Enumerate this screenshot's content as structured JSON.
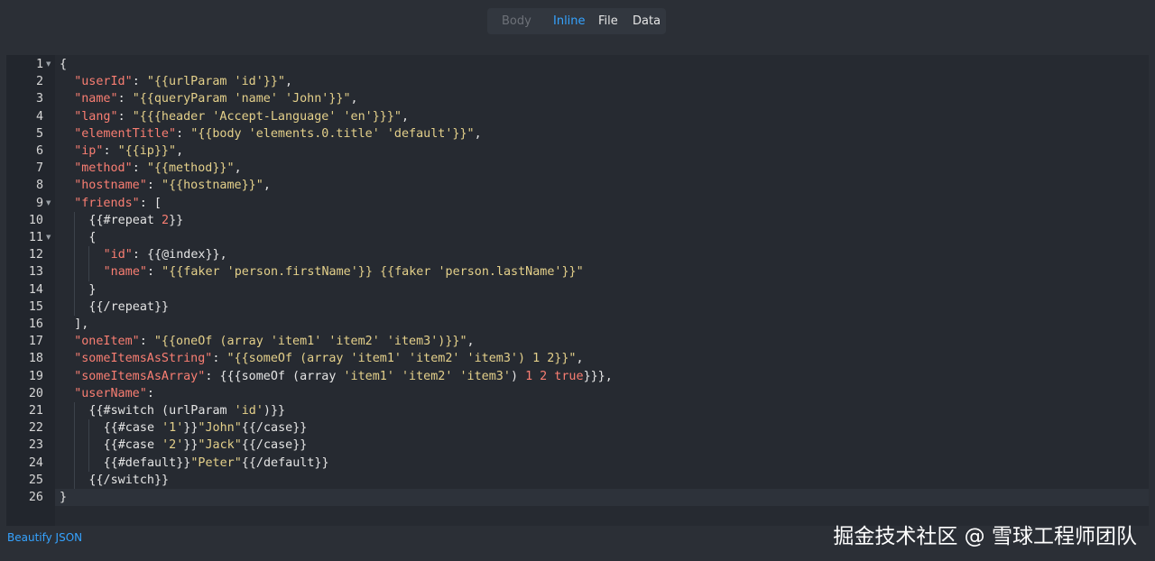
{
  "tabs": [
    {
      "label": "Body",
      "state": "disabled"
    },
    {
      "label": "Inline",
      "state": "active"
    },
    {
      "label": "File",
      "state": "normal"
    },
    {
      "label": "Data",
      "state": "normal"
    }
  ],
  "editor": {
    "lines": [
      {
        "no": "1",
        "fold": true,
        "indent": 0,
        "tokens": [
          [
            "p",
            "{"
          ]
        ]
      },
      {
        "no": "2",
        "indent": 1,
        "tokens": [
          [
            "k",
            "\"userId\""
          ],
          [
            "p",
            ": "
          ],
          [
            "s",
            "\"{{urlParam 'id'}}\""
          ],
          [
            "p",
            ","
          ]
        ]
      },
      {
        "no": "3",
        "indent": 1,
        "tokens": [
          [
            "k",
            "\"name\""
          ],
          [
            "p",
            ": "
          ],
          [
            "s",
            "\"{{queryParam 'name' 'John'}}\""
          ],
          [
            "p",
            ","
          ]
        ]
      },
      {
        "no": "4",
        "indent": 1,
        "tokens": [
          [
            "k",
            "\"lang\""
          ],
          [
            "p",
            ": "
          ],
          [
            "s",
            "\"{{{header 'Accept-Language' 'en'}}}\""
          ],
          [
            "p",
            ","
          ]
        ]
      },
      {
        "no": "5",
        "indent": 1,
        "tokens": [
          [
            "k",
            "\"elementTitle\""
          ],
          [
            "p",
            ": "
          ],
          [
            "s",
            "\"{{body 'elements.0.title' 'default'}}\""
          ],
          [
            "p",
            ","
          ]
        ]
      },
      {
        "no": "6",
        "indent": 1,
        "tokens": [
          [
            "k",
            "\"ip\""
          ],
          [
            "p",
            ": "
          ],
          [
            "s",
            "\"{{ip}}\""
          ],
          [
            "p",
            ","
          ]
        ]
      },
      {
        "no": "7",
        "indent": 1,
        "tokens": [
          [
            "k",
            "\"method\""
          ],
          [
            "p",
            ": "
          ],
          [
            "s",
            "\"{{method}}\""
          ],
          [
            "p",
            ","
          ]
        ]
      },
      {
        "no": "8",
        "indent": 1,
        "tokens": [
          [
            "k",
            "\"hostname\""
          ],
          [
            "p",
            ": "
          ],
          [
            "s",
            "\"{{hostname}}\""
          ],
          [
            "p",
            ","
          ]
        ]
      },
      {
        "no": "9",
        "fold": true,
        "indent": 1,
        "tokens": [
          [
            "k",
            "\"friends\""
          ],
          [
            "p",
            ": ["
          ]
        ]
      },
      {
        "no": "10",
        "indent": 2,
        "tokens": [
          [
            "t",
            "{{#repeat "
          ],
          [
            "n",
            "2"
          ],
          [
            "t",
            "}}"
          ]
        ]
      },
      {
        "no": "11",
        "fold": true,
        "indent": 2,
        "tokens": [
          [
            "p",
            "{"
          ]
        ]
      },
      {
        "no": "12",
        "indent": 3,
        "tokens": [
          [
            "k",
            "\"id\""
          ],
          [
            "p",
            ": "
          ],
          [
            "t",
            "{{@index}},"
          ]
        ]
      },
      {
        "no": "13",
        "indent": 3,
        "tokens": [
          [
            "k",
            "\"name\""
          ],
          [
            "p",
            ": "
          ],
          [
            "s",
            "\"{{faker 'person.firstName'}} {{faker 'person.lastName'}}\""
          ]
        ]
      },
      {
        "no": "14",
        "indent": 2,
        "tokens": [
          [
            "p",
            "}"
          ]
        ]
      },
      {
        "no": "15",
        "indent": 2,
        "tokens": [
          [
            "t",
            "{{/repeat}}"
          ]
        ]
      },
      {
        "no": "16",
        "indent": 1,
        "tokens": [
          [
            "p",
            "],"
          ]
        ]
      },
      {
        "no": "17",
        "indent": 1,
        "tokens": [
          [
            "k",
            "\"oneItem\""
          ],
          [
            "p",
            ": "
          ],
          [
            "s",
            "\"{{oneOf (array 'item1' 'item2' 'item3')}}\""
          ],
          [
            "p",
            ","
          ]
        ]
      },
      {
        "no": "18",
        "indent": 1,
        "tokens": [
          [
            "k",
            "\"someItemsAsString\""
          ],
          [
            "p",
            ": "
          ],
          [
            "s",
            "\"{{someOf (array 'item1' 'item2' 'item3') 1 2}}\""
          ],
          [
            "p",
            ","
          ]
        ]
      },
      {
        "no": "19",
        "indent": 1,
        "tokens": [
          [
            "k",
            "\"someItemsAsArray\""
          ],
          [
            "p",
            ": "
          ],
          [
            "t",
            "{{{someOf (array "
          ],
          [
            "s",
            "'item1' 'item2' 'item3'"
          ],
          [
            "t",
            ") "
          ],
          [
            "n",
            "1 2 true"
          ],
          [
            "t",
            "}}},"
          ]
        ]
      },
      {
        "no": "20",
        "indent": 1,
        "tokens": [
          [
            "k",
            "\"userName\""
          ],
          [
            "p",
            ":"
          ]
        ]
      },
      {
        "no": "21",
        "indent": 2,
        "tokens": [
          [
            "t",
            "{{#switch (urlParam "
          ],
          [
            "s",
            "'id'"
          ],
          [
            "t",
            ")}}"
          ]
        ]
      },
      {
        "no": "22",
        "indent": 3,
        "tokens": [
          [
            "t",
            "{{#case "
          ],
          [
            "s",
            "'1'"
          ],
          [
            "t",
            "}}"
          ],
          [
            "s",
            "\"John\""
          ],
          [
            "t",
            "{{/case}}"
          ]
        ]
      },
      {
        "no": "23",
        "indent": 3,
        "tokens": [
          [
            "t",
            "{{#case "
          ],
          [
            "s",
            "'2'"
          ],
          [
            "t",
            "}}"
          ],
          [
            "s",
            "\"Jack\""
          ],
          [
            "t",
            "{{/case}}"
          ]
        ]
      },
      {
        "no": "24",
        "indent": 3,
        "tokens": [
          [
            "t",
            "{{#default}}"
          ],
          [
            "s",
            "\"Peter\""
          ],
          [
            "t",
            "{{/default}}"
          ]
        ]
      },
      {
        "no": "25",
        "indent": 2,
        "tokens": [
          [
            "t",
            "{{/switch}}"
          ]
        ]
      },
      {
        "no": "26",
        "indent": 0,
        "current": true,
        "tokens": [
          [
            "p",
            "}"
          ]
        ]
      }
    ]
  },
  "footer": {
    "beautify_label": "Beautify JSON"
  },
  "watermark": "掘金技术社区 @ 雪球工程师团队",
  "colors": {
    "accent": "#35a3ff",
    "key": "#f97e72",
    "string": "#e4d08a"
  }
}
